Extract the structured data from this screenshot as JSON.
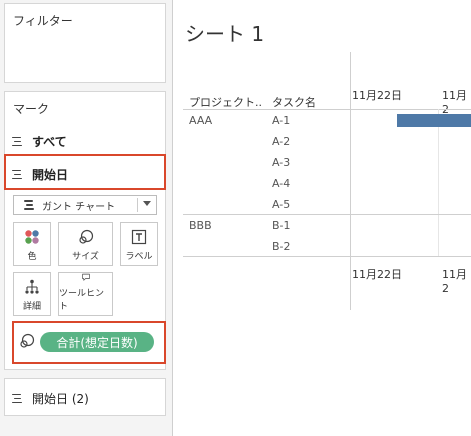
{
  "filters": {
    "title": "フィルター"
  },
  "marks": {
    "title": "マーク",
    "rows": [
      {
        "label": "すべて"
      },
      {
        "label": "開始日"
      }
    ],
    "mark_type": "ガント チャート",
    "buttons": [
      {
        "label": "色",
        "icon": "color-dots-icon"
      },
      {
        "label": "サイズ",
        "icon": "size-circles-icon"
      },
      {
        "label": "ラベル",
        "icon": "text-label-icon"
      },
      {
        "label": "詳細",
        "icon": "detail-tree-icon"
      },
      {
        "label": "ツールヒント",
        "icon": "tooltip-bubble-icon"
      }
    ],
    "size_pill": "合計(想定日数)",
    "detail_row": "開始日 (2)"
  },
  "sheet": {
    "title": "シート 1",
    "col_headers": [
      "プロジェクト..",
      "タスク名"
    ],
    "date_ticks": [
      "11月22日",
      "11月2"
    ],
    "groups": [
      {
        "project": "AAA",
        "tasks": [
          "A-1",
          "A-2",
          "A-3",
          "A-4",
          "A-5"
        ]
      },
      {
        "project": "BBB",
        "tasks": [
          "B-1",
          "B-2"
        ]
      }
    ]
  },
  "colors": {
    "highlight": "#d9472b",
    "pill": "#59b385",
    "bar": "#4e79a7"
  }
}
